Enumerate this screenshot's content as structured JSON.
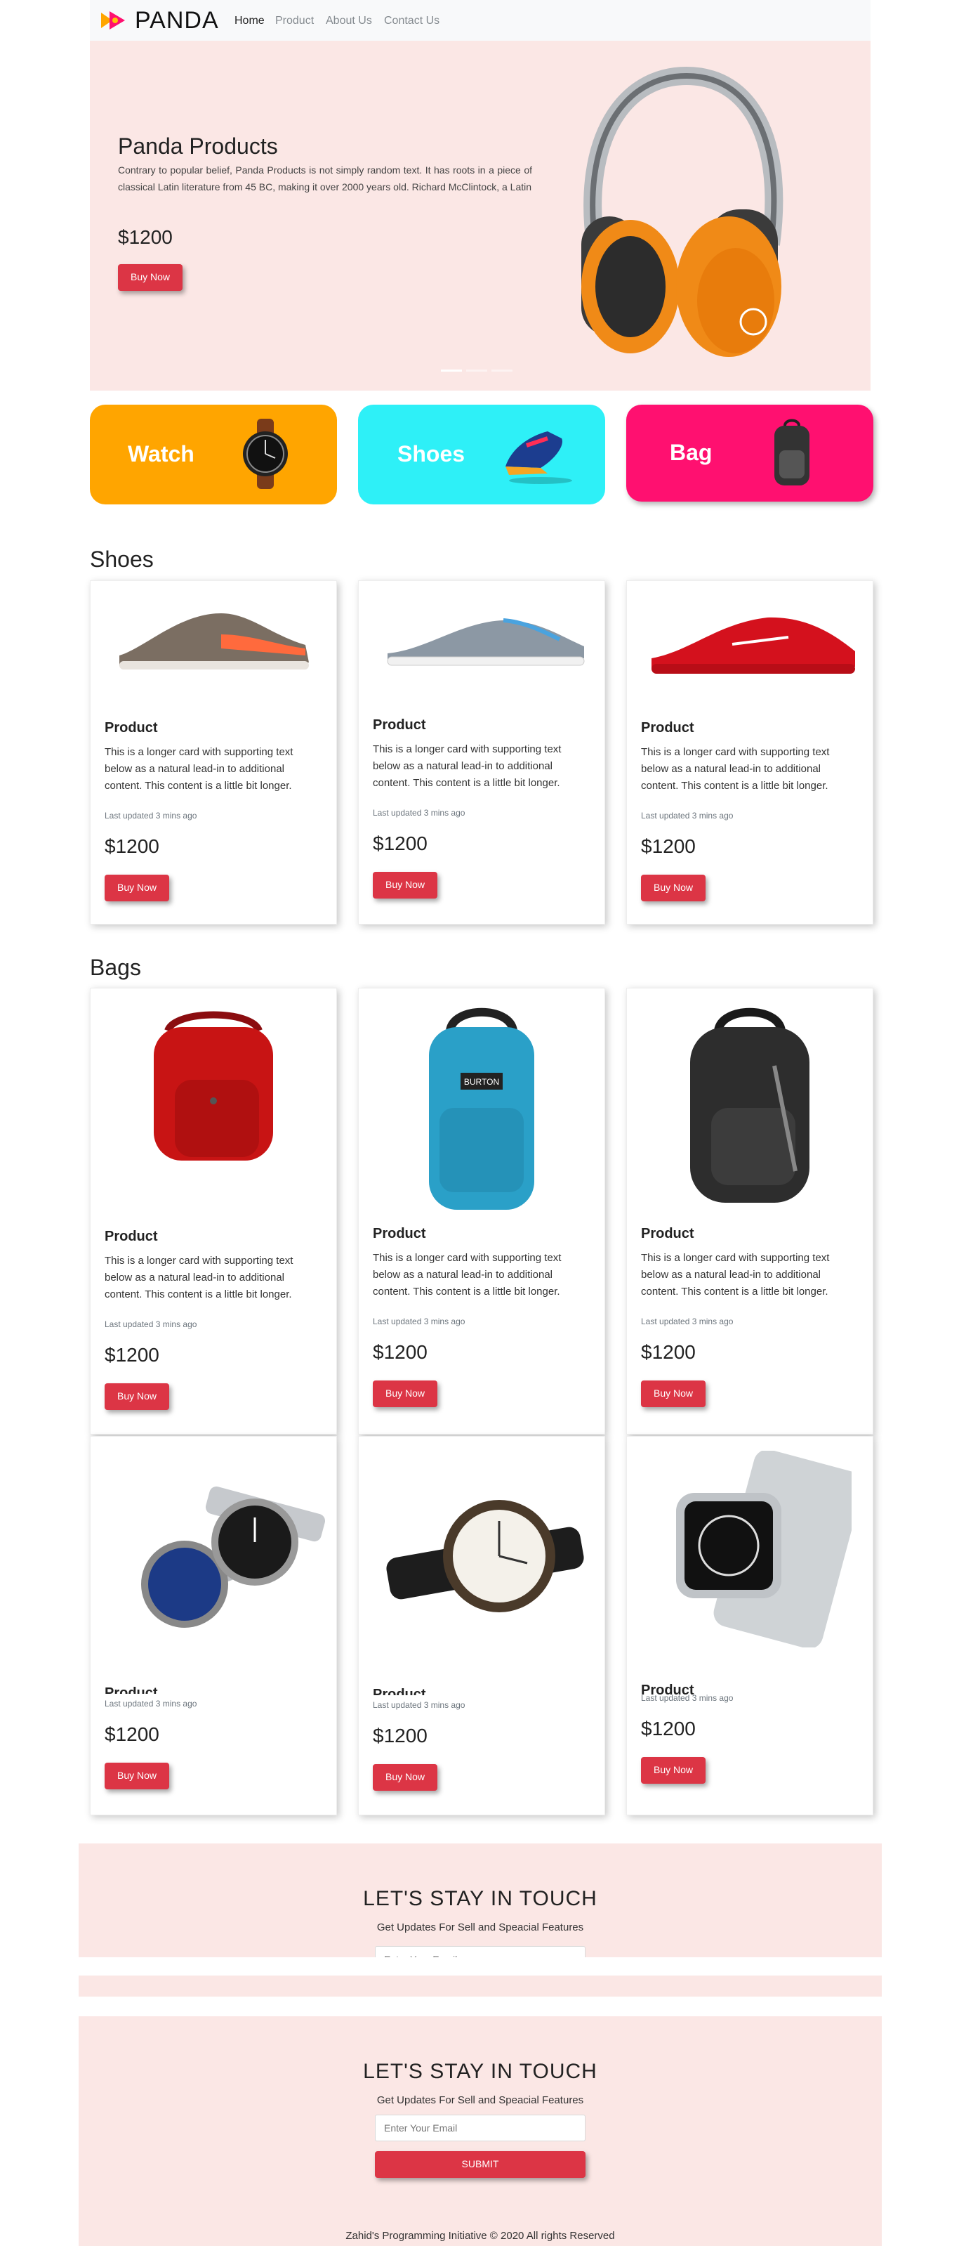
{
  "nav": {
    "brand": "PANDA",
    "links": [
      "Home",
      "Product",
      "About Us",
      "Contact Us"
    ],
    "active": "Home"
  },
  "hero": {
    "title": "Panda Products",
    "text": "Contrary to popular belief, Panda Products is not simply random text. It has roots in a piece of classical Latin literature from 45 BC, making it over 2000 years old. Richard McClintock, a Latin",
    "price": "$1200",
    "button": "Buy Now",
    "image_icon": "headphones-image"
  },
  "categories": [
    {
      "label": "Watch",
      "color": "#ffa500",
      "icon": "watch-image"
    },
    {
      "label": "Shoes",
      "color": "#2ef0f7",
      "icon": "shoe-image"
    },
    {
      "label": "Bag",
      "color": "#ff1070",
      "icon": "backpack-image"
    }
  ],
  "sections": {
    "shoes": "Shoes",
    "bags": "Bags"
  },
  "card_common": {
    "title": "Product",
    "text": "This is a longer card with supporting text below as a natural lead-in to additional content. This content is a little bit longer.",
    "meta": "Last updated 3 mins ago",
    "price": "$1200",
    "button": "Buy Now"
  },
  "shoe_cards": [
    {
      "title": "Product",
      "image": "sneaker-grey-orange-image"
    },
    {
      "title": "Product",
      "image": "sneaker-grey-white-image"
    },
    {
      "title": "Product",
      "image": "sneaker-red-image"
    }
  ],
  "bag_cards": [
    {
      "title": "Product",
      "image": "red-backpack-image"
    },
    {
      "title": "Product",
      "image": "blue-backpack-image",
      "brand_tag": "BURTON"
    },
    {
      "title": "Product",
      "image": "black-backpack-image"
    }
  ],
  "watch_cards": [
    {
      "title": "Product",
      "image": "two-watches-image"
    },
    {
      "title": "Product",
      "image": "leather-watch-image"
    },
    {
      "title": "Product",
      "image": "smartwatch-image"
    }
  ],
  "newsletter": {
    "title": "LET'S STAY IN TOUCH",
    "subtitle": "Get Updates For Sell and Speacial Features",
    "placeholder": "Enter Your Email",
    "submit": "SUBMIT"
  },
  "footer": {
    "text": "Zahid's Programming Initiative © 2020 All rights Reserved"
  },
  "colors": {
    "accent": "#dc3545",
    "hero_bg": "#fbe7e5",
    "navbar_bg": "#f8f9fa"
  }
}
